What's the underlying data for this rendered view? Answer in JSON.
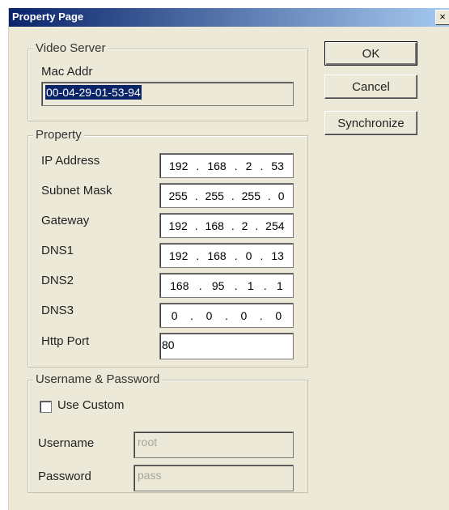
{
  "window": {
    "title": "Property Page",
    "close_glyph": "×"
  },
  "video_server": {
    "legend": "Video Server",
    "mac_label": "Mac Addr",
    "mac_value": "00-04-29-01-53-94"
  },
  "property": {
    "legend": "Property",
    "ip_label": "IP Address",
    "ip": [
      "192",
      "168",
      "2",
      "53"
    ],
    "subnet_label": "Subnet Mask",
    "subnet": [
      "255",
      "255",
      "255",
      "0"
    ],
    "gateway_label": "Gateway",
    "gateway": [
      "192",
      "168",
      "2",
      "254"
    ],
    "dns1_label": "DNS1",
    "dns1": [
      "192",
      "168",
      "0",
      "13"
    ],
    "dns2_label": "DNS2",
    "dns2": [
      "168",
      "95",
      "1",
      "1"
    ],
    "dns3_label": "DNS3",
    "dns3": [
      "0",
      "0",
      "0",
      "0"
    ],
    "http_label": "Http Port",
    "http_value": "80"
  },
  "credentials": {
    "legend": "Username & Password",
    "use_custom_label": "Use Custom",
    "use_custom_checked": false,
    "username_label": "Username",
    "username_value": "root",
    "password_label": "Password",
    "password_value": "pass"
  },
  "buttons": {
    "ok": "OK",
    "cancel": "Cancel",
    "synchronize": "Synchronize"
  },
  "colors": {
    "title_start": "#0a246a",
    "title_end": "#a6caf0",
    "dialog_bg": "#ece9d8",
    "selection": "#0a246a"
  }
}
